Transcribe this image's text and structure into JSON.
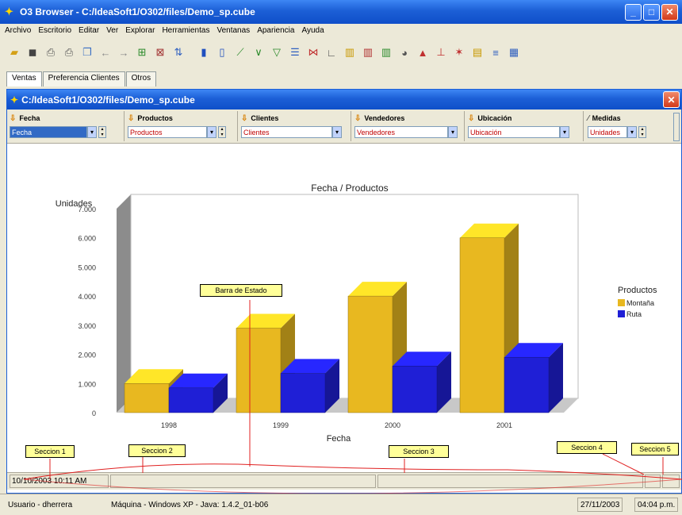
{
  "window": {
    "title": "O3 Browser - C:/IdeaSoft1/O302/files/Demo_sp.cube"
  },
  "menu": [
    "Archivo",
    "Escritorio",
    "Editar",
    "Ver",
    "Explorar",
    "Herramientas",
    "Ventanas",
    "Apariencia",
    "Ayuda"
  ],
  "tabs": [
    "Ventas",
    "Preferencia Clientes",
    "Otros"
  ],
  "inner_window": {
    "title": "C:/IdeaSoft1/O302/files/Demo_sp.cube"
  },
  "dimensions": [
    {
      "label": "Fecha",
      "value": "Fecha"
    },
    {
      "label": "Productos",
      "value": "Productos"
    },
    {
      "label": "Clientes",
      "value": "Clientes"
    },
    {
      "label": "Vendedores",
      "value": "Vendedores"
    },
    {
      "label": "Ubicación",
      "value": "Ubicación"
    },
    {
      "label": "Medidas",
      "value": "Unidades"
    }
  ],
  "chart_data": {
    "type": "bar",
    "title": "Fecha / Productos",
    "xlabel": "Fecha",
    "ylabel": "Unidades",
    "categories": [
      "1998",
      "1999",
      "2000",
      "2001"
    ],
    "series": [
      {
        "name": "Montaña",
        "color": "#e8b820",
        "values": [
          1000,
          2900,
          4000,
          6000
        ]
      },
      {
        "name": "Ruta",
        "color": "#1f1fd6",
        "values": [
          850,
          1350,
          1600,
          1900
        ]
      }
    ],
    "yticks": [
      "0",
      "1.000",
      "2.000",
      "3.000",
      "4.000",
      "5.000",
      "6.000",
      "7.000"
    ],
    "ylim": [
      0,
      7000
    ],
    "legend_title": "Productos",
    "legend_position": "right",
    "grid": false
  },
  "callouts": {
    "barra_estado": "Barra de Estado",
    "seccion1": "Seccion 1",
    "seccion2": "Seccion 2",
    "seccion3": "Seccion 3",
    "seccion4": "Seccion 4",
    "seccion5": "Seccion 5"
  },
  "inner_status": {
    "datetime": "10/10/2003 10:11 AM"
  },
  "app_status": {
    "user": "Usuario - dherrera",
    "machine": "Máquina - Windows XP - Java: 1.4.2_01-b06",
    "date": "27/11/2003",
    "time": "04:04 p.m."
  }
}
